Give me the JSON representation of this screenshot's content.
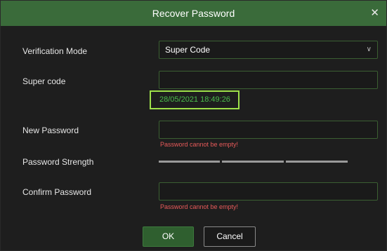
{
  "dialog": {
    "title": "Recover Password",
    "close_glyph": "✕"
  },
  "form": {
    "verification_mode": {
      "label": "Verification Mode",
      "value": "Super Code"
    },
    "super_code": {
      "label": "Super code",
      "value": "",
      "timestamp": "28/05/2021 18:49:26"
    },
    "new_password": {
      "label": "New Password",
      "value": "",
      "error": "Password cannot be empty!"
    },
    "password_strength": {
      "label": "Password Strength",
      "segments": 3
    },
    "confirm_password": {
      "label": "Confirm Password",
      "value": "",
      "error": "Password cannot be empty!"
    }
  },
  "buttons": {
    "ok": "OK",
    "cancel": "Cancel"
  },
  "colors": {
    "titlebar": "#3a6b3a",
    "field_border": "#3b5f32",
    "error": "#e85a5a",
    "timestamp_text": "#4bbf4b",
    "timestamp_highlight": "#9ee04a"
  },
  "icons": {
    "close": "close-icon",
    "dropdown": "chevron-down-icon"
  }
}
